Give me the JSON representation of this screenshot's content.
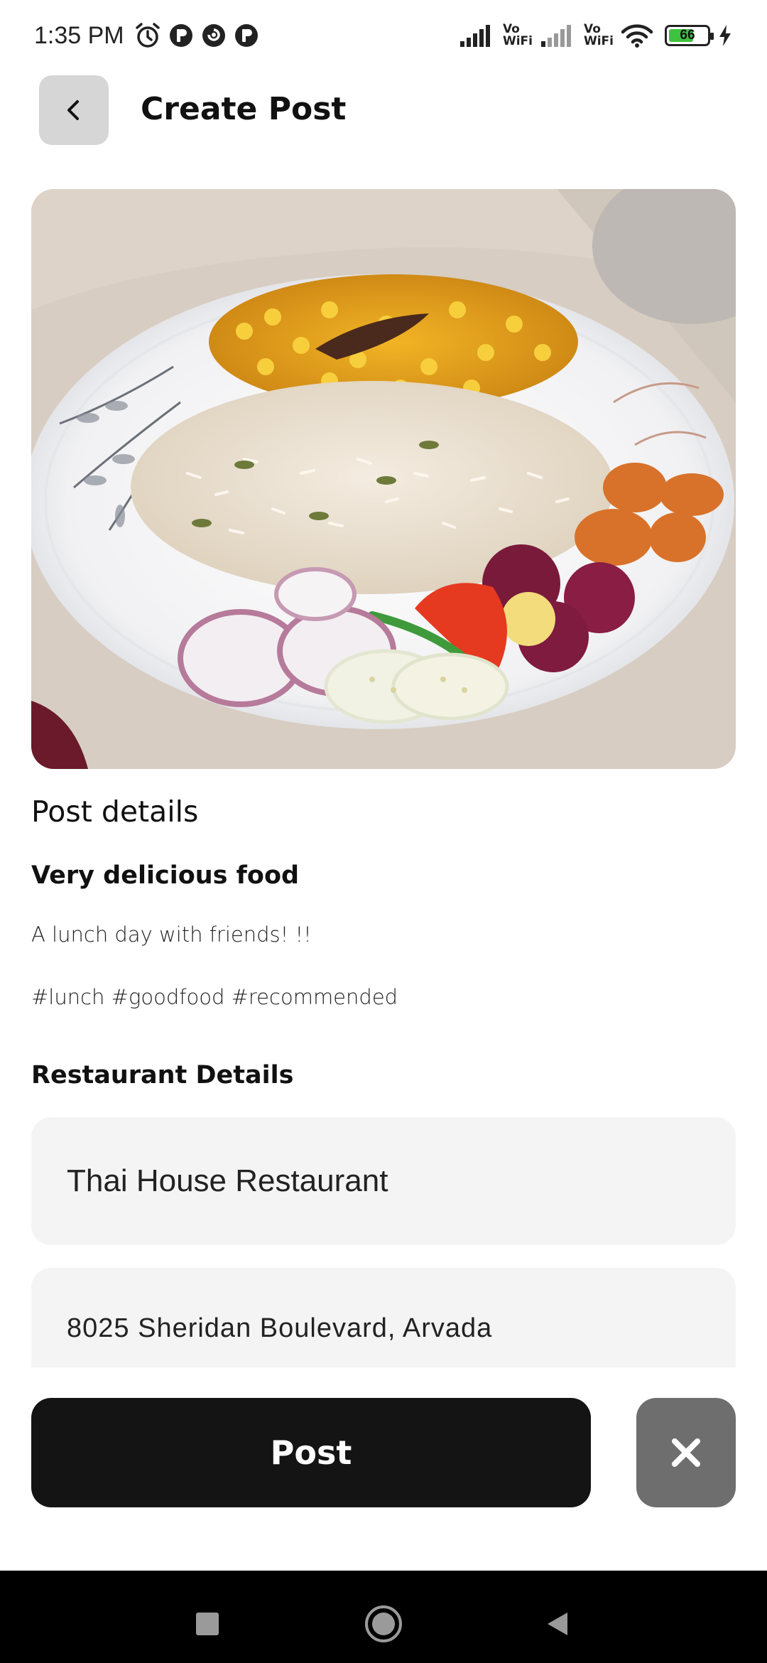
{
  "status_bar": {
    "time": "1:35 PM",
    "icons": [
      "alarm-icon",
      "app-notification-icon",
      "app-notification-icon",
      "app-notification-icon"
    ],
    "network": [
      "signal-icon",
      "vowifi-icon",
      "signal-icon",
      "vowifi-icon",
      "wifi-icon"
    ],
    "vowifi_top": "Vo",
    "vowifi_bottom": "WiFi",
    "battery_level": "66",
    "battery_color": "#3fc23f",
    "charging_icon": "bolt-icon"
  },
  "header": {
    "back_icon": "chevron-left-icon",
    "title": "Create Post"
  },
  "photo": {
    "subject": "food-photo"
  },
  "details": {
    "section_title": "Post details",
    "heading": "Very delicious food",
    "description": "A lunch day with friends! !!",
    "hashtags": "#lunch #goodfood #recommended"
  },
  "restaurant": {
    "section_title": "Restaurant Details",
    "name": "Thai House Restaurant",
    "address": "8025 Sheridan Boulevard, Arvada"
  },
  "actions": {
    "post_label": "Post",
    "close_icon": "close-icon",
    "post_color": "#141414",
    "close_color": "#6e6e6e"
  },
  "nav": {
    "recents_icon": "square-icon",
    "home_icon": "circle-icon",
    "back_icon": "triangle-back-icon"
  }
}
